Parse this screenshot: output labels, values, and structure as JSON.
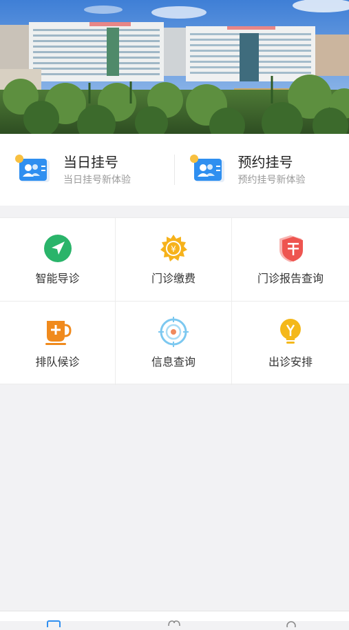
{
  "banner": {
    "icon": "hospital-building-photo"
  },
  "registration": {
    "today": {
      "title": "当日挂号",
      "subtitle": "当日挂号新体验",
      "icon": "id-card-icon"
    },
    "appointment": {
      "title": "预约挂号",
      "subtitle": "预约挂号新体验",
      "icon": "id-card-icon"
    }
  },
  "services": [
    {
      "label": "智能导诊",
      "icon": "navigation-arrow-icon",
      "color": "#2ab46a"
    },
    {
      "label": "门诊缴费",
      "icon": "yuan-coin-icon",
      "color": "#f6b21b"
    },
    {
      "label": "门诊报告查询",
      "icon": "report-shield-icon",
      "color": "#ee5550"
    },
    {
      "label": "排队候诊",
      "icon": "cup-plus-icon",
      "color": "#f08a1d"
    },
    {
      "label": "信息查询",
      "icon": "target-icon",
      "color": "#7cc8f0"
    },
    {
      "label": "出诊安排",
      "icon": "lightbulb-icon",
      "color": "#f4b81a"
    }
  ],
  "tabbar": {
    "icons": [
      "home-tab-icon",
      "heart-tab-icon",
      "profile-tab-icon"
    ],
    "accent": "#2f8ff0"
  }
}
